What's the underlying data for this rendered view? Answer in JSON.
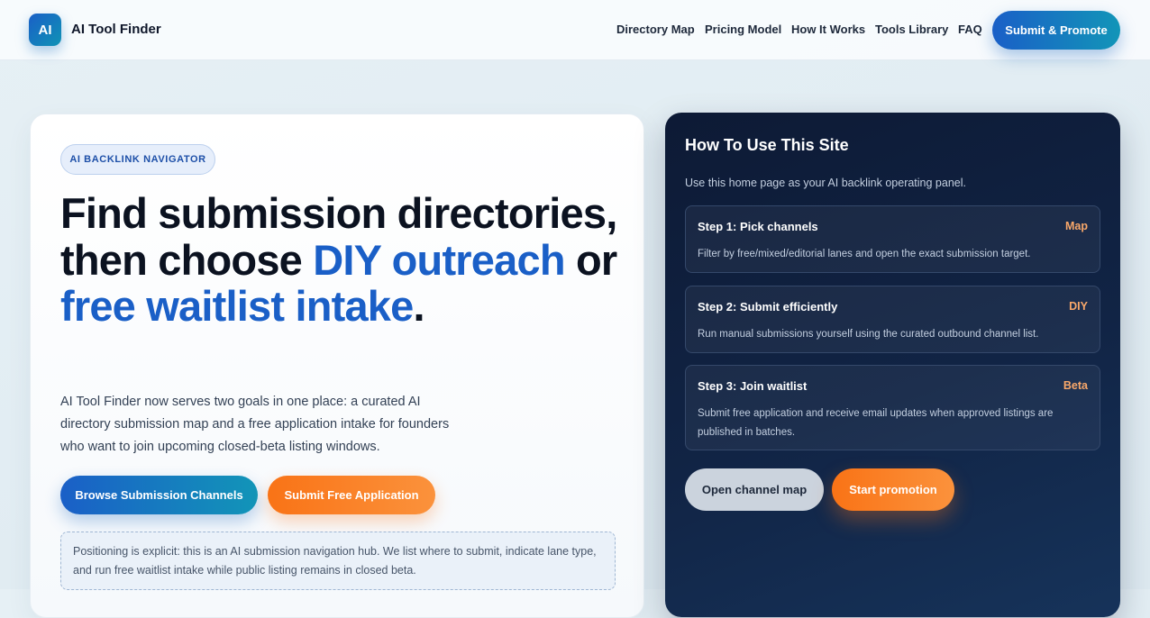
{
  "brand": {
    "logo_text": "AI",
    "name": "AI Tool Finder"
  },
  "nav": {
    "links": [
      "Directory Map",
      "Pricing Model",
      "How It Works",
      "Tools Library",
      "FAQ"
    ],
    "cta": "Submit & Promote"
  },
  "hero": {
    "eyebrow": "AI BACKLINK NAVIGATOR",
    "headline": {
      "part1": "Find submission directories, then choose ",
      "accent1": "DIY outreach",
      "part2": " or ",
      "accent2": "free waitlist intake",
      "part3": "."
    },
    "intro": "AI Tool Finder now serves two goals in one place: a curated AI directory submission map and a free application intake for founders who want to join upcoming closed-beta listing windows.",
    "primary_button": "Browse Submission Channels",
    "secondary_button": "Submit Free Application",
    "note": "Positioning is explicit: this is an AI submission navigation hub. We list where to submit, indicate lane type, and run free waitlist intake while public listing remains in closed beta."
  },
  "guide": {
    "title": "How To Use This Site",
    "subtitle": "Use this home page as your AI backlink operating panel.",
    "steps": [
      {
        "title": "Step 1: Pick channels",
        "tag": "Map",
        "desc": "Filter by free/mixed/editorial lanes and open the exact submission target."
      },
      {
        "title": "Step 2: Submit efficiently",
        "tag": "DIY",
        "desc": "Run manual submissions yourself using the curated outbound channel list."
      },
      {
        "title": "Step 3: Join waitlist",
        "tag": "Beta",
        "desc": "Submit free application and receive email updates when approved listings are published in batches."
      }
    ],
    "buttons": {
      "secondary": "Open channel map",
      "primary": "Start promotion"
    }
  },
  "colors": {
    "brand_blue": "#1a5fc7",
    "accent_orange": "#f97316",
    "panel_dark": "#0d1a35",
    "tag_orange": "#f9a86a"
  }
}
